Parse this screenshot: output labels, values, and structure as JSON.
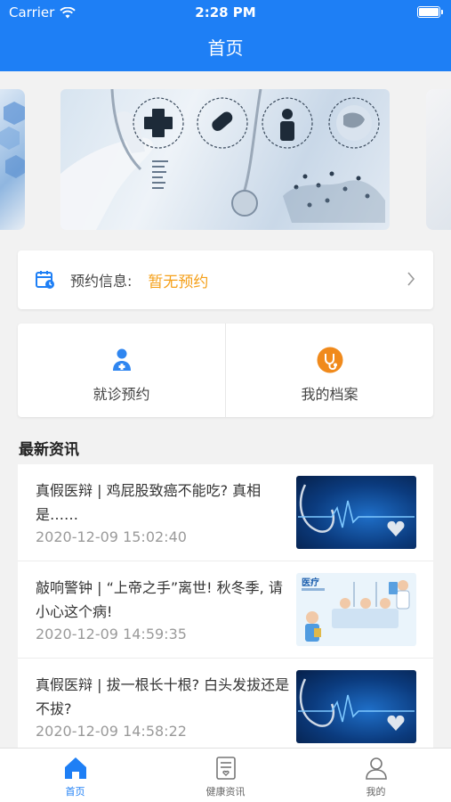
{
  "status_bar": {
    "carrier": "Carrier",
    "time": "2:28 PM"
  },
  "nav": {
    "title": "首页"
  },
  "appointment": {
    "label": "预约信息:",
    "value": "暂无预约"
  },
  "actions": [
    {
      "label": "就诊预约",
      "icon": "doctor-icon"
    },
    {
      "label": "我的档案",
      "icon": "stethoscope-icon"
    }
  ],
  "news_section": {
    "title": "最新资讯"
  },
  "news": [
    {
      "title": "真假医辩 | 鸡屁股致癌不能吃? 真相是……",
      "date": "2020-12-09 15:02:40",
      "thumb": "stethoscope-heartbeat"
    },
    {
      "title": "敲响警钟 | “上帝之手”离世! 秋冬季, 请小心这个病!",
      "date": "2020-12-09 14:59:35",
      "thumb": "clinic-illustration",
      "thumb_text": "医疗"
    },
    {
      "title": "真假医辩 | 拔一根长十根? 白头发拔还是不拔?",
      "date": "2020-12-09 14:58:22",
      "thumb": "stethoscope-heartbeat"
    }
  ],
  "tabbar": [
    {
      "label": "首页",
      "icon": "home-icon",
      "active": true
    },
    {
      "label": "健康资讯",
      "icon": "news-icon",
      "active": false
    },
    {
      "label": "我的",
      "icon": "user-icon",
      "active": false
    }
  ],
  "colors": {
    "primary": "#1e7ff5",
    "accent": "#f5a01a",
    "action_orange": "#f08a1c"
  }
}
